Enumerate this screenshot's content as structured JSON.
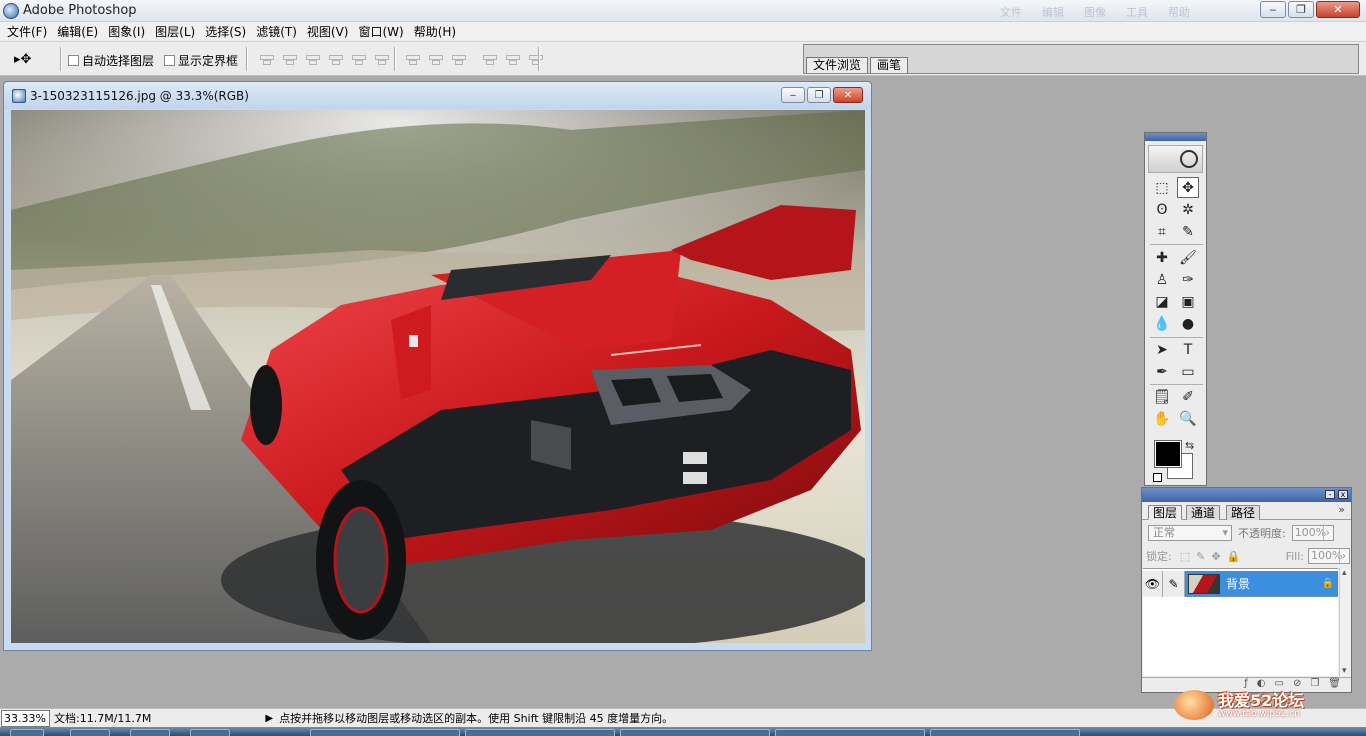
{
  "app": {
    "title": "Adobe Photoshop",
    "window_controls": {
      "minimize": "‒",
      "restore": "❐",
      "close": "✕"
    },
    "title_ghost_items": [
      "文件",
      "编辑",
      "图像",
      "工具",
      "帮助"
    ]
  },
  "menu": [
    "文件(F)",
    "编辑(E)",
    "图象(I)",
    "图层(L)",
    "选择(S)",
    "滤镜(T)",
    "视图(V)",
    "窗口(W)",
    "帮助(H)"
  ],
  "options_bar": {
    "move_tool_glyph": "▸✥",
    "auto_select_label": "自动选择图层",
    "show_bounds_label": "显示定界框",
    "palette_well_tabs": [
      "文件浏览",
      "画笔"
    ]
  },
  "document": {
    "title": "3-150323115126.jpg @ 33.3%(RGB)",
    "controls": {
      "minimize": "‒",
      "restore": "❐",
      "close": "✕"
    }
  },
  "tools": {
    "items": [
      {
        "name": "marquee-tool",
        "glyph": "⬚"
      },
      {
        "name": "move-tool",
        "glyph": "✥",
        "active": true
      },
      {
        "name": "lasso-tool",
        "glyph": "ʘ"
      },
      {
        "name": "magic-wand-tool",
        "glyph": "✲"
      },
      {
        "name": "crop-tool",
        "glyph": "⌗"
      },
      {
        "name": "slice-tool",
        "glyph": "✎"
      },
      {
        "name": "healing-brush-tool",
        "glyph": "✚"
      },
      {
        "name": "brush-tool",
        "glyph": "🖌"
      },
      {
        "name": "clone-stamp-tool",
        "glyph": "♙"
      },
      {
        "name": "history-brush-tool",
        "glyph": "✑"
      },
      {
        "name": "eraser-tool",
        "glyph": "◪"
      },
      {
        "name": "gradient-tool",
        "glyph": "▣"
      },
      {
        "name": "blur-tool",
        "glyph": "💧"
      },
      {
        "name": "dodge-tool",
        "glyph": "●"
      },
      {
        "name": "path-selection-tool",
        "glyph": "➤"
      },
      {
        "name": "type-tool",
        "glyph": "T"
      },
      {
        "name": "pen-tool",
        "glyph": "✒"
      },
      {
        "name": "shape-tool",
        "glyph": "▭"
      },
      {
        "name": "notes-tool",
        "glyph": "🗒"
      },
      {
        "name": "eyedropper-tool",
        "glyph": "✐"
      },
      {
        "name": "hand-tool",
        "glyph": "✋"
      },
      {
        "name": "zoom-tool",
        "glyph": "🔍"
      }
    ],
    "swap_glyph": "⇆",
    "foreground_color": "#000000",
    "background_color": "#ffffff"
  },
  "layers_panel": {
    "tabs": [
      "图层",
      "通道",
      "路径"
    ],
    "menu_glyph": "»",
    "blend_mode": "正常",
    "opacity_label": "不透明度:",
    "opacity_value": "100%",
    "lock_label": "锁定:",
    "lock_icons": [
      "⬚",
      "✎",
      "✥",
      "🔒"
    ],
    "fill_label": "Fill:",
    "fill_value": "100%",
    "layers": [
      {
        "name": "背景",
        "visible_glyph": "👁",
        "brush_glyph": "✎",
        "lock_glyph": "🔒",
        "selected": true
      }
    ],
    "footer_icons": [
      "ƒ",
      "◐",
      "▭",
      "⊘",
      "❐",
      "🗑"
    ]
  },
  "status": {
    "zoom": "33.33%",
    "doc_size": "文档:11.7M/11.7M",
    "arrow": "▶",
    "hint": "点按并拖移以移动图层或移动选区的副本。使用 Shift 键限制沿 45 度增量方向。"
  },
  "watermark": {
    "text": "我爱52论坛",
    "url": "www.tao.wip52.cn"
  },
  "colors": {
    "accent": "#3c8fdf",
    "car_red": "#c8181c"
  }
}
